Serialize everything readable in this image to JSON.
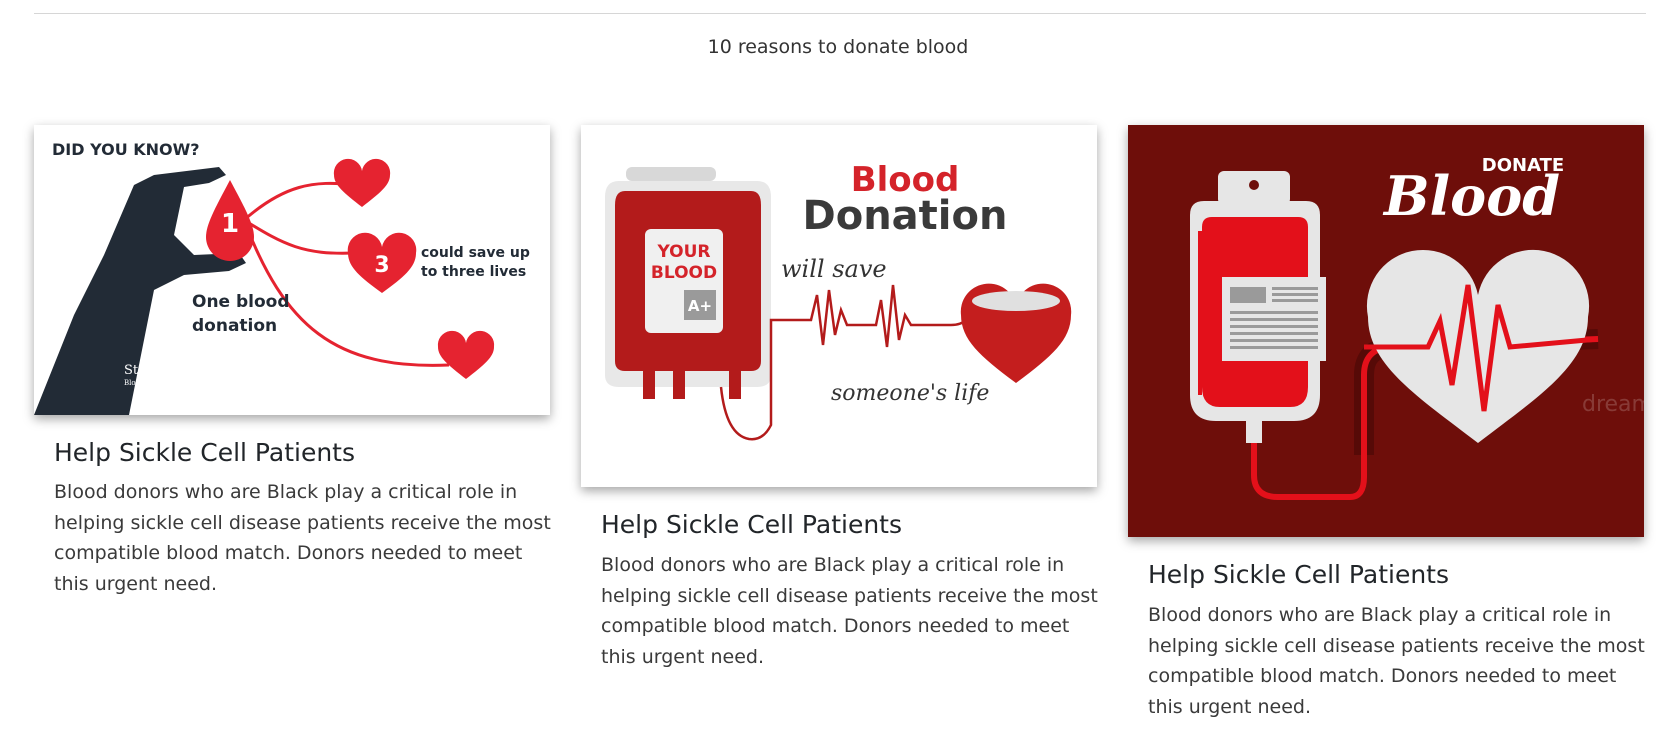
{
  "section": {
    "heading": "10 reasons to donate blood"
  },
  "cards": [
    {
      "title": "Help Sickle Cell Patients",
      "text": "Blood donors who are Black play a critical role in helping sickle cell disease patients receive the most compatible blood match. Donors needed to meet this urgent need.",
      "image": {
        "headline": "DID YOU KNOW?",
        "drop_number": "1",
        "heart_number": "3",
        "caption_line1": "could save up",
        "caption_line2": "to three lives",
        "main_line1": "One blood",
        "main_line2": "donation",
        "logo_line1": "Stanford",
        "logo_line2": "Blood Center"
      }
    },
    {
      "title": "Help Sickle Cell Patients",
      "text": "Blood donors who are Black play a critical role in helping sickle cell disease patients receive the most compatible blood match. Donors needed to meet this urgent need.",
      "image": {
        "title_line1": "Blood",
        "title_line2": "Donation",
        "bag_label1": "YOUR",
        "bag_label2": "BLOOD",
        "blood_type": "A+",
        "script_top": "will save",
        "script_bottom": "someone's life"
      }
    },
    {
      "title": "Help Sickle Cell Patients",
      "text": "Blood donors who are Black play a critical role in helping sickle cell disease patients receive the most compatible blood match. Donors needed to meet this urgent need.",
      "image": {
        "title_small": "DONATE",
        "title_big": "Blood",
        "watermark": "dreamstime"
      }
    }
  ]
}
